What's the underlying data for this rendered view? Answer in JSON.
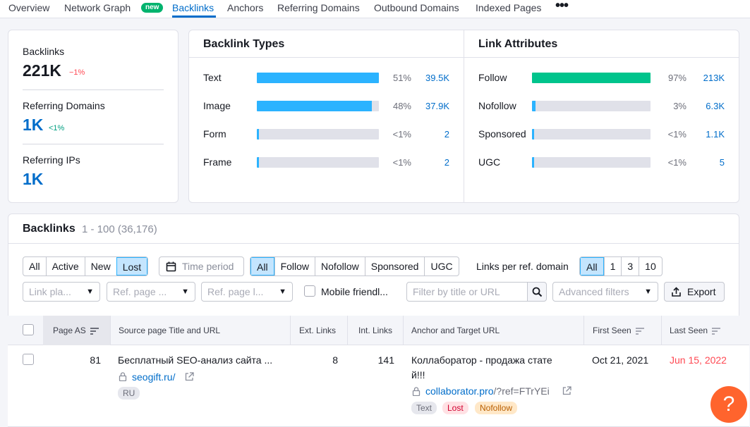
{
  "nav": {
    "tabs": [
      "Overview",
      "Network Graph",
      "Backlinks",
      "Anchors",
      "Referring Domains",
      "Outbound Domains",
      "Indexed Pages"
    ],
    "new_badge": "new",
    "more": "•••",
    "active_tab": "Backlinks"
  },
  "summary": {
    "backlinks": {
      "label": "Backlinks",
      "value": "221K",
      "delta": "−1%",
      "delta_color": "#ff4953"
    },
    "ref_domains": {
      "label": "Referring Domains",
      "value": "1K",
      "delta": "<1%",
      "delta_color": "#009f81"
    },
    "ref_ips": {
      "label": "Referring IPs",
      "value": "1K"
    }
  },
  "backlink_types": {
    "title": "Backlink Types",
    "color": "#2bb3ff",
    "rows": [
      {
        "label": "Text",
        "pct": "51%",
        "count": "39.5K",
        "fill": 1.0
      },
      {
        "label": "Image",
        "pct": "48%",
        "count": "37.9K",
        "fill": 0.94
      },
      {
        "label": "Form",
        "pct": "<1%",
        "count": "2",
        "fill": 0.01
      },
      {
        "label": "Frame",
        "pct": "<1%",
        "count": "2",
        "fill": 0.01
      }
    ]
  },
  "link_attributes": {
    "title": "Link Attributes",
    "follow_color": "#00c48c",
    "other_color": "#2bb3ff",
    "rows": [
      {
        "label": "Follow",
        "pct": "97%",
        "count": "213K",
        "fill": 1.0
      },
      {
        "label": "Nofollow",
        "pct": "3%",
        "count": "6.3K",
        "fill": 0.03
      },
      {
        "label": "Sponsored",
        "pct": "<1%",
        "count": "1.1K",
        "fill": 0.01
      },
      {
        "label": "UGC",
        "pct": "<1%",
        "count": "5",
        "fill": 0.01
      }
    ]
  },
  "backlinks_table": {
    "title": "Backlinks",
    "subtitle": "1 - 100 (36,176)",
    "type_filter": [
      "All",
      "Active",
      "New",
      "Lost"
    ],
    "type_selected": "Lost",
    "time_period": "Time period",
    "attr_filter": [
      "All",
      "Follow",
      "Nofollow",
      "Sponsored",
      "UGC"
    ],
    "attr_selected": "All",
    "links_per_domain_label": "Links per ref. domain",
    "links_per_domain": [
      "All",
      "1",
      "3",
      "10"
    ],
    "links_per_domain_selected": "All",
    "selects": [
      "Link pla...",
      "Ref. page ...",
      "Ref. page l..."
    ],
    "mobile_friendly": "Mobile friendl...",
    "search_placeholder": "Filter by title or URL",
    "advanced_filters": "Advanced filters",
    "export": "Export",
    "columns": [
      "Page AS",
      "Source page Title and URL",
      "Ext. Links",
      "Int. Links",
      "Anchor and Target URL",
      "First Seen",
      "Last Seen"
    ],
    "rows": [
      {
        "page_as": "81",
        "source_title": "Бесплатный SEO-анализ сайта ...",
        "source_url": "seogift.ru/",
        "lang": "RU",
        "ext_links": "8",
        "int_links": "141",
        "anchor_line1": "Коллаборатор - продажа стате",
        "anchor_line2": "й!!!",
        "target_domain": "collaborator.pro",
        "target_path": "/?ref=FTrYEi",
        "tags": [
          "Text",
          "Lost",
          "Nofollow"
        ],
        "first_seen": "Oct 21, 2021",
        "last_seen": "Jun 15, 2022",
        "last_seen_color": "#ff4953"
      }
    ]
  },
  "help": "?"
}
